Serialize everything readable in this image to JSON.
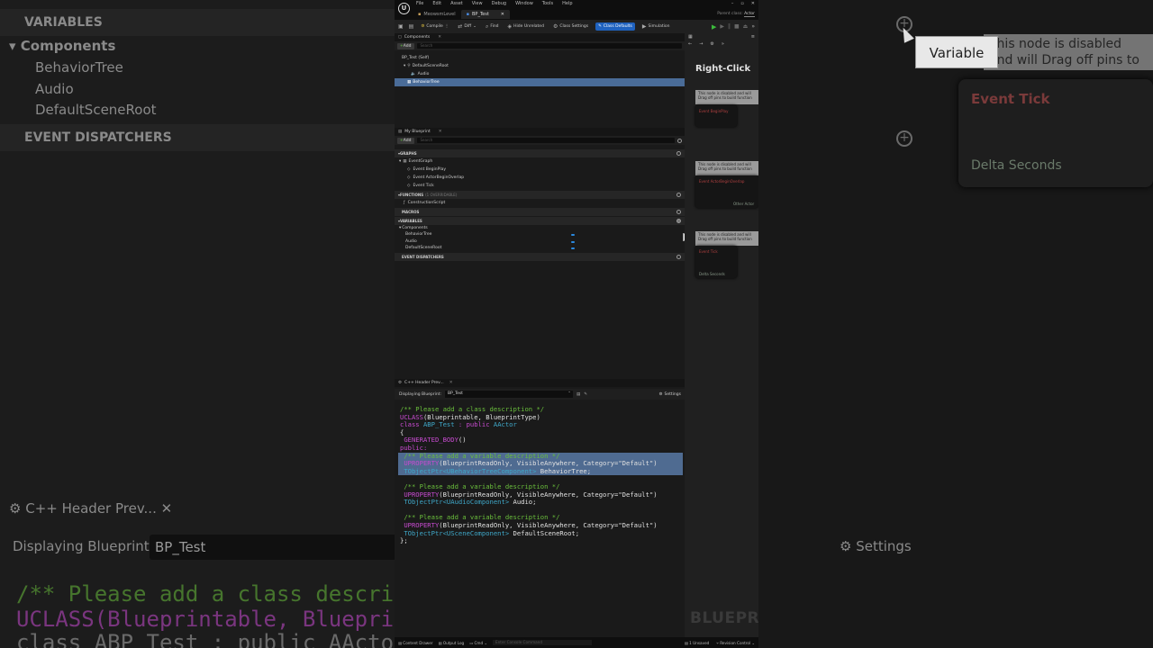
{
  "background_left": {
    "variables_header": "VARIABLES",
    "components_label": "Components",
    "items": [
      "BehaviorTree",
      "Audio",
      "DefaultSceneRoot"
    ],
    "event_dispatchers_header": "EVENT DISPATCHERS",
    "cpp_tab": "C++ Header Prev...",
    "displaying_label": "Displaying Blueprint:",
    "displaying_value": "BP_Test",
    "code_lines": [
      "/** Please add a class descrip",
      "UCLASS(Blueprintable, Blueprin",
      "class ABP_Test : public AActo"
    ]
  },
  "background_right": {
    "tooltip": "Variable",
    "comment": "This node is disabled and will\nDrag off pins to build functio",
    "node_title": "Event Tick",
    "pin_label": "Delta Seconds",
    "settings": "Settings"
  },
  "window": {
    "menu": [
      "File",
      "Edit",
      "Asset",
      "View",
      "Debug",
      "Window",
      "Tools",
      "Help"
    ],
    "doc_tabs": [
      "MeowsmLevel",
      "BP_Test"
    ],
    "parent_class_label": "Parent class:",
    "parent_class_value": "Actor"
  },
  "toolbar": {
    "compile": "Compile",
    "diff": "Diff",
    "find": "Find",
    "hide_unrelated": "Hide Unrelated",
    "class_settings": "Class Settings",
    "class_defaults": "Class Defaults",
    "simulation": "Simulation"
  },
  "components_panel": {
    "tab": "Components",
    "add": "Add",
    "search_placeholder": "Search",
    "root": "BP_Test (Self)",
    "items": [
      "DefaultSceneRoot",
      "Audio",
      "BehaviorTree"
    ]
  },
  "my_blueprint": {
    "tab": "My Blueprint",
    "add": "Add",
    "search_placeholder": "Search",
    "graphs_header": "GRAPHS",
    "event_graph": "EventGraph",
    "events": [
      "Event BeginPlay",
      "Event ActorBeginOverlap",
      "Event Tick"
    ],
    "functions_header": "FUNCTIONS",
    "functions_note": "(1 OVERRIDABLE)",
    "functions": [
      "ConstructionScript"
    ],
    "macros_header": "MACROS",
    "variables_header": "VARIABLES",
    "components_label": "Components",
    "variables": [
      "BehaviorTree",
      "Audio",
      "DefaultSceneRoot"
    ],
    "dispatchers_header": "EVENT DISPATCHERS",
    "tooltip": "Variable"
  },
  "cpp_preview": {
    "tab": "C++ Header Prev...",
    "displaying_label": "Displaying Blueprint:",
    "displaying_value": "BP_Test",
    "settings": "Settings",
    "line1": "/** Please add a class description */",
    "line2a": "UCLASS",
    "line2b": "(Blueprintable, BlueprintType)",
    "line3a": "class ",
    "line3b": "ABP_Test",
    "line3c": " : public ",
    "line3d": "AActor",
    "line4": "{",
    "line5": "GENERATED_BODY",
    "line5b": "()",
    "line6": "public:",
    "var_comment": "/** Please add a variable description */",
    "uprop": "UPROPERTY",
    "uprop_args": "(BlueprintReadOnly, VisibleAnywhere, Category=\"Default\")",
    "v1_type": "TObjectPtr<UBehaviorTreeComponent>",
    "v1_name": " BehaviorTree;",
    "v2_type": "TObjectPtr<UAudioComponent>",
    "v2_name": " Audio;",
    "v3_type": "TObjectPtr<USceneComponent>",
    "v3_name": " DefaultSceneRoot;",
    "end": "};"
  },
  "graph": {
    "hint": "Right-Click",
    "comment": "This node is disabled and will\nDrag off pins to build function",
    "node1": "Event BeginPlay",
    "node2": "Event ActorBeginOverlap",
    "node2_pin": "Other Actor",
    "node3": "Event Tick",
    "node3_pin": "Delta Seconds",
    "watermark": "BLUEPR"
  },
  "statusbar": {
    "content_drawer": "Content Drawer",
    "output_log": "Output Log",
    "cmd": "Cmd",
    "cmd_placeholder": "Enter Console Command",
    "unsaved": "1 Unsaved",
    "revision": "Revision Control"
  }
}
